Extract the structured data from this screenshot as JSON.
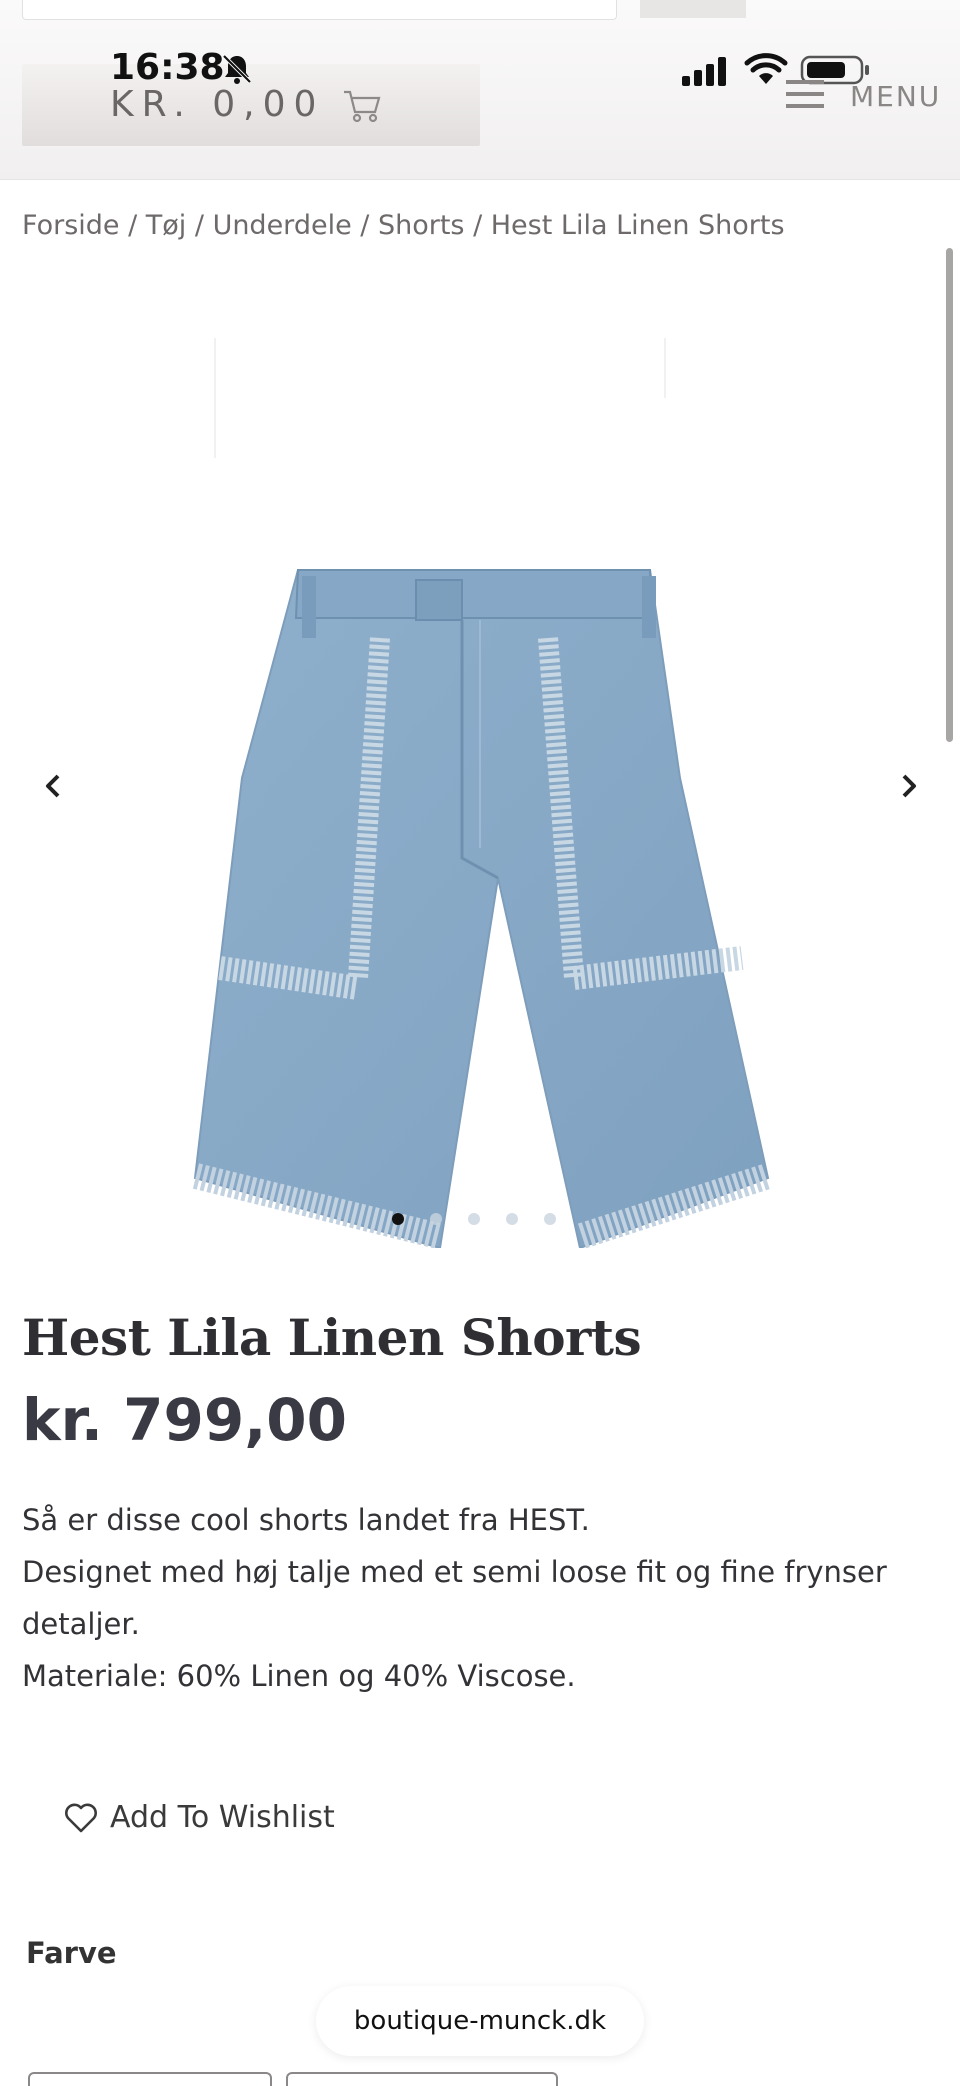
{
  "status_bar": {
    "time": "16:38"
  },
  "header": {
    "cart_amount": "KR. 0,00",
    "menu_label": "MENU"
  },
  "breadcrumb": [
    "Forside",
    "Tøj",
    "Underdele",
    "Shorts",
    "Hest Lila Linen Shorts"
  ],
  "gallery": {
    "slide_count": 5,
    "active_slide": 1
  },
  "product": {
    "title": "Hest Lila Linen Shorts",
    "price": "kr. 799,00",
    "description": [
      "Så er disse cool shorts landet fra HEST.",
      "Designet med høj talje med et semi loose fit og fine frynser detaljer.",
      "Materiale: 60% Linen og 40% Viscose."
    ],
    "wishlist_label": "Add To Wishlist",
    "color_label": "Farve"
  },
  "browser": {
    "url": "boutique-munck.dk"
  },
  "colors": {
    "accent": "#3a3a45",
    "denim": "#8fb0cc"
  }
}
